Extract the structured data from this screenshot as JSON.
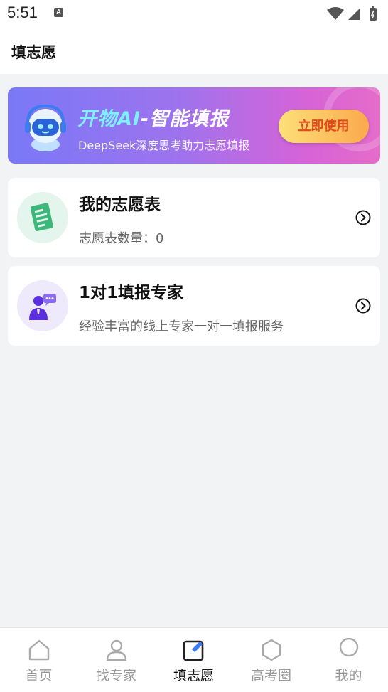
{
  "status": {
    "time": "5:51",
    "notification_glyph": "A"
  },
  "header": {
    "title": "填志愿"
  },
  "banner": {
    "title_highlight": "开物AI",
    "title_rest": "-智能填报",
    "subtitle": "DeepSeek深度思考助力志愿填报",
    "button_label": "立即使用",
    "icon": "robot-icon"
  },
  "cards": [
    {
      "title": "我的志愿表",
      "subtitle": "志愿表数量：0",
      "icon": "document-icon",
      "accent": "#3bb87a"
    },
    {
      "title": "1对1填报专家",
      "subtitle": "经验丰富的线上专家一对一填报服务",
      "icon": "consultant-icon",
      "accent": "#6a3fe0"
    }
  ],
  "tabbar": {
    "tabs": [
      {
        "label": "首页",
        "icon": "home-icon",
        "active": false
      },
      {
        "label": "找专家",
        "icon": "person-icon",
        "active": false
      },
      {
        "label": "填志愿",
        "icon": "edit-icon",
        "active": true
      },
      {
        "label": "高考圈",
        "icon": "hexagon-icon",
        "active": false
      },
      {
        "label": "我的",
        "icon": "profile-circle-icon",
        "active": false
      }
    ]
  },
  "colors": {
    "primary": "#3b7bf6",
    "banner_start": "#7a78f7",
    "banner_end": "#e56cc9",
    "button_text": "#e04a1e"
  }
}
